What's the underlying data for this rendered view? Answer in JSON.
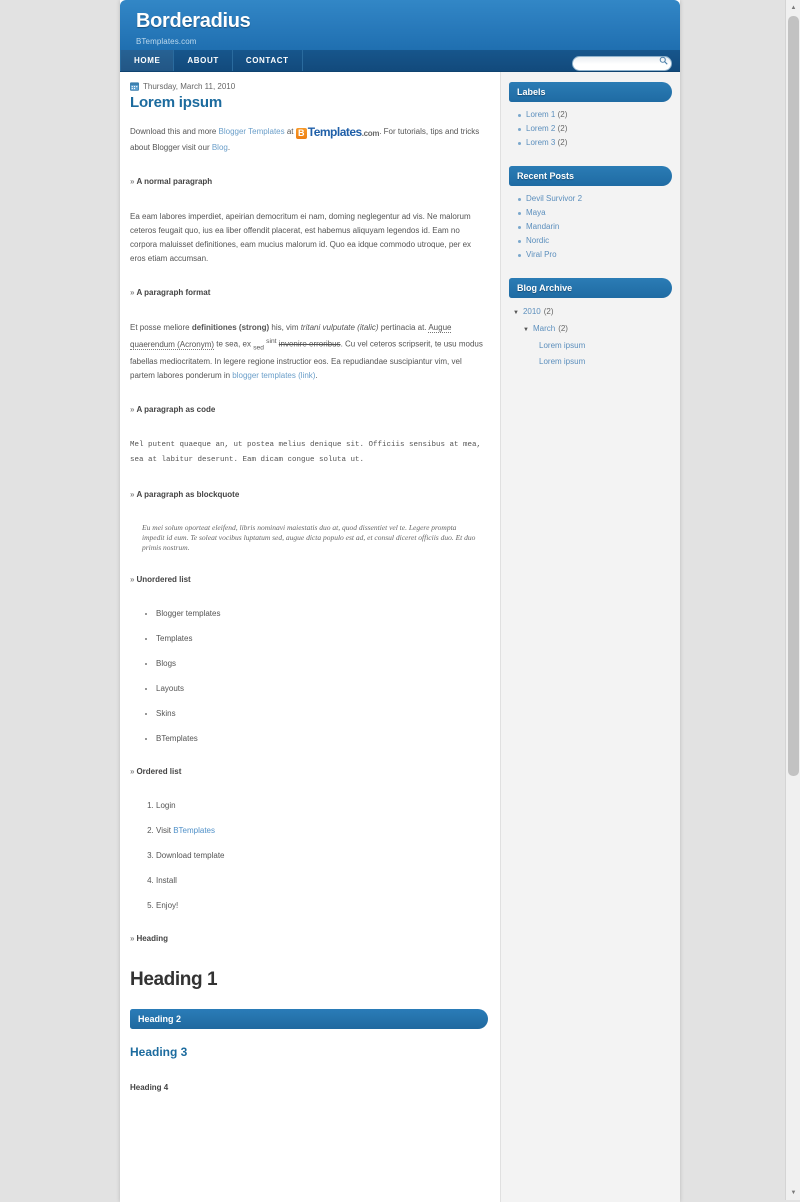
{
  "header": {
    "blog_title": "Borderadius",
    "blog_description": "BTemplates.com",
    "nav": [
      {
        "label": "HOME",
        "active": true
      },
      {
        "label": "ABOUT",
        "active": false
      },
      {
        "label": "CONTACT",
        "active": false
      }
    ],
    "search": {
      "value": "",
      "placeholder": "",
      "icon": "search-icon"
    }
  },
  "post": {
    "date_icon": "calendar-icon",
    "date": "Thursday, March 11, 2010",
    "title": "Lorem ipsum",
    "intro": {
      "part1": "Download this and more ",
      "link1": "Blogger Templates",
      "part2": " at ",
      "logo_b": "B",
      "logo_templates": "Templates",
      "logo_com": ".com",
      "part3": ". For tutorials, tips and tricks about Blogger visit our ",
      "link2": "Blog",
      "part4": "."
    },
    "sections": {
      "normal_paragraph": {
        "heading": "A normal paragraph",
        "text": "Ea eam labores imperdiet, apeirian democritum ei nam, doming neglegentur ad vis. Ne malorum ceteros feugait quo, ius ea liber offendit placerat, est habemus aliquyam legendos id. Eam no corpora maluisset definitiones, eam mucius malorum id. Quo ea idque commodo utroque, per ex eros etiam accumsan."
      },
      "paragraph_format": {
        "heading": "A paragraph format",
        "t1": "Et posse meliore ",
        "strong": "definitiones (strong)",
        "t2": " his, vim ",
        "italic": "tritani vulputate (italic)",
        "t3": " pertinacia at. ",
        "acronym": "Augue quaerendum (Acronym)",
        "t4": " te sea, ex ",
        "sub": "sed",
        "sup": "sint",
        "strike": "invenire erroribus",
        "t5": ". Cu vel ceteros scripserit, te usu modus fabellas mediocritatem. In legere regione instructior eos. Ea repudiandae suscipiantur vim, vel partem labores ponderum in ",
        "link": "blogger templates (link)",
        "t6": "."
      },
      "paragraph_code": {
        "heading": "A paragraph as code",
        "code": "Mel putent quaeque an, ut postea melius denique sit. Officiis sensibus at mea, sea at labitur deserunt. Eam dicam congue soluta ut."
      },
      "paragraph_blockquote": {
        "heading": "A paragraph as blockquote",
        "quote": "Eu mei solum oporteat eleifend, libris nominavi maiestatis duo at, quod dissentiet vel te. Legere prompta impedit id eum. Te soleat vocibus luptatum sed, augue dicta populo est ad, et consul diceret officiis duo. Et duo primis nostrum."
      },
      "unordered_list": {
        "heading": "Unordered list",
        "items": [
          "Blogger templates",
          "Templates",
          "Blogs",
          "Layouts",
          "Skins",
          "BTemplates"
        ]
      },
      "ordered_list": {
        "heading": "Ordered list",
        "items": [
          {
            "text": "Login",
            "link": ""
          },
          {
            "text": "Visit ",
            "link": "BTemplates"
          },
          {
            "text": "Download template",
            "link": ""
          },
          {
            "text": "Install",
            "link": ""
          },
          {
            "text": "Enjoy!",
            "link": ""
          }
        ]
      },
      "headings": {
        "heading": "Heading",
        "h1": "Heading 1",
        "h2": "Heading 2",
        "h3": "Heading 3",
        "h4": "Heading 4"
      }
    }
  },
  "sidebar": {
    "labels": {
      "title": "Labels",
      "items": [
        {
          "label": "Lorem 1",
          "count": "(2)"
        },
        {
          "label": "Lorem 2",
          "count": "(2)"
        },
        {
          "label": "Lorem 3",
          "count": "(2)"
        }
      ]
    },
    "recent_posts": {
      "title": "Recent Posts",
      "items": [
        "Devil Survivor 2",
        "Maya",
        "Mandarin",
        "Nordic",
        "Viral Pro"
      ]
    },
    "blog_archive": {
      "title": "Blog Archive",
      "year": {
        "triangle": "▼",
        "label": "2010",
        "count": "(2)"
      },
      "month": {
        "triangle": "▼",
        "label": "March",
        "count": "(2)"
      },
      "posts": [
        "Lorem ipsum",
        "Lorem ipsum"
      ]
    }
  },
  "scrollbar": {
    "up_arrow": "▲",
    "down_arrow": "▼"
  },
  "colors": {
    "header_blue": "#2a7cbd",
    "navbar_navy": "#134a7a",
    "widget_blue": "#2273ad",
    "link_blue": "#5c8fbd",
    "heading_blue": "#1c6b9e",
    "logo_orange": "#ee7f13",
    "page_bg": "#e2e2e2"
  }
}
